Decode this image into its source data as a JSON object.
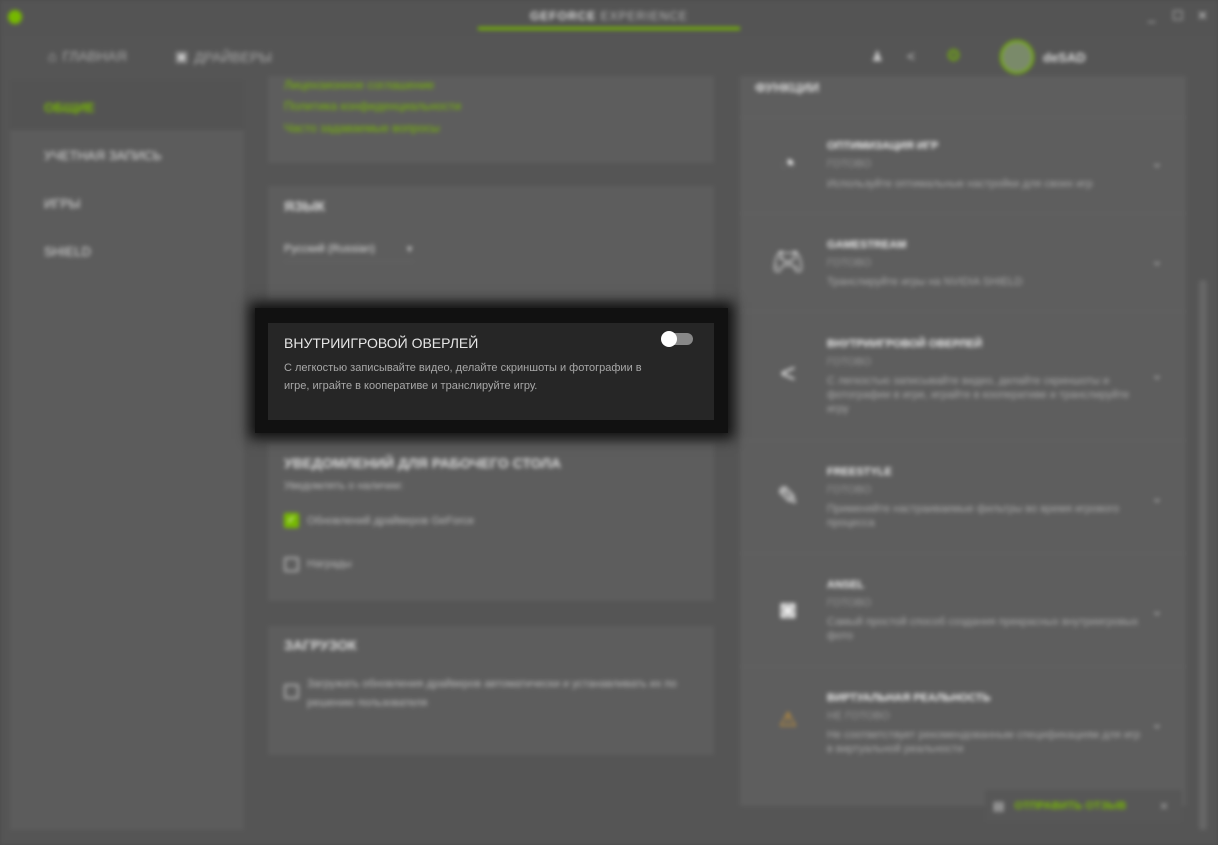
{
  "window": {
    "brand_bold": "GEFORCE",
    "brand_light": "EXPERIENCE",
    "minimize": "_",
    "maximize": "☐",
    "close": "✕"
  },
  "nav": {
    "home": "ГЛАВНАЯ",
    "drivers": "ДРАЙВЕРЫ",
    "username": "deSAD"
  },
  "sidebar": {
    "items": [
      {
        "label": "ОБЩИЕ"
      },
      {
        "label": "УЧЕТНАЯ ЗАПИСЬ"
      },
      {
        "label": "ИГРЫ"
      },
      {
        "label": "SHIELD"
      }
    ]
  },
  "about": {
    "links": [
      "Лицензионное соглашение",
      "Политика конфиденциальности",
      "Часто задаваемые вопросы"
    ]
  },
  "language": {
    "title": "ЯЗЫК",
    "selected": "Русский (Russian)"
  },
  "overlay": {
    "title": "ВНУТРИИГРОВОЙ ОВЕРЛЕЙ",
    "description": "С легкостью записывайте видео, делайте скриншоты и фотографии в игре, играйте в кооперативе и транслируйте игру.",
    "enabled": false
  },
  "notifications": {
    "title": "УВЕДОМЛЕНИЙ ДЛЯ РАБОЧЕГО СТОЛА",
    "subtitle": "Уведомлять о наличии:",
    "options": [
      {
        "label": "Обновлений драйверов GeForce",
        "checked": true
      },
      {
        "label": "Награды",
        "checked": false
      }
    ]
  },
  "downloads": {
    "title": "ЗАГРУЗОК",
    "option": "Загружать обновления драйверов автоматически и устанавливать их по решению пользователя",
    "checked": false
  },
  "features": {
    "title": "ФУНКЦИИ",
    "items": [
      {
        "icon": "gauge-icon",
        "title": "ОПТИМИЗАЦИЯ ИГР",
        "status": "ГОТОВО",
        "desc": "Используйте оптимальные настройки для своих игр"
      },
      {
        "icon": "gamepad-icon",
        "title": "GAMESTREAM",
        "status": "ГОТОВО",
        "desc": "Транслируйте игры на NVIDIA SHIELD"
      },
      {
        "icon": "share-icon",
        "title": "ВНУТРИИГРОВОЙ ОВЕРЛЕЙ",
        "status": "ГОТОВО",
        "desc": "С легкостью записывайте видео, делайте скриншоты и фотографии в игре, играйте в кооперативе и транслируйте игру"
      },
      {
        "icon": "freestyle-icon",
        "title": "FREESTYLE",
        "status": "ГОТОВО",
        "desc": "Применяйте настраиваемые фильтры во время игрового процесса"
      },
      {
        "icon": "camera-icon",
        "title": "ANSEL",
        "status": "ГОТОВО",
        "desc": "Самый простой способ создания прекрасных внутриигровых фото"
      },
      {
        "icon": "vr-warning-icon",
        "title": "ВИРТУАЛЬНАЯ РЕАЛЬНОСТЬ",
        "status": "НЕ ГОТОВО",
        "desc": "Не соответствует рекомендованным спецификациям для игр в виртуальной реальности"
      }
    ]
  },
  "feedback": {
    "label": "ОТПРАВИТЬ ОТЗЫВ",
    "close": "✕"
  },
  "colors": {
    "accent": "#76b900",
    "warning": "#e0a030"
  }
}
